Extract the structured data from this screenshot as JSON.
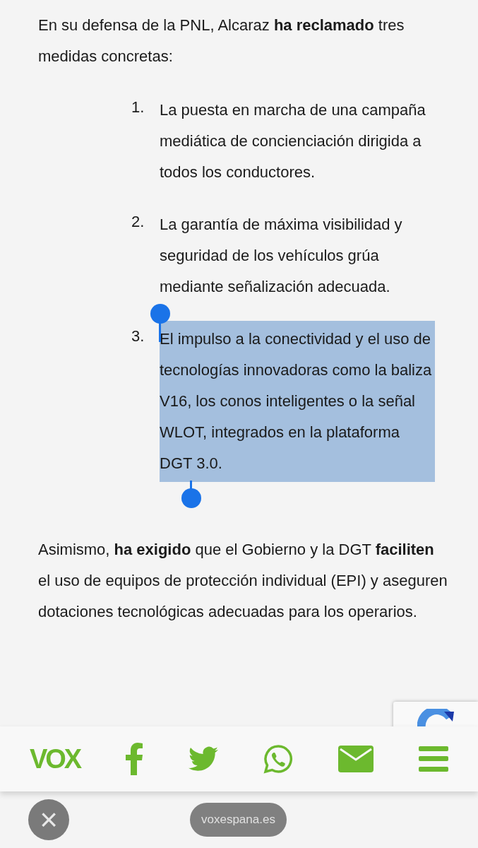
{
  "intro": "En su defensa de la PNL, Alcaraz **ha reclamado** tres medidas concretas:",
  "measures": [
    {
      "number": "1.",
      "text": "La puesta en marcha de una campaña mediática de concienciación dirigida a todos los conductores.",
      "selected": false
    },
    {
      "number": "2.",
      "text": "La garantía de máxima visibilidad y seguridad de los vehículos grúa mediante señalización adecuada.",
      "selected": false
    },
    {
      "number": "3.",
      "text": "El impulso a la conectividad y el uso de tecnologías innovadoras como la baliza V16, los conos inteligentes o la señal WLOT, integrados en la plataforma DGT 3.0.",
      "selected": true
    }
  ],
  "paragraph": "Asimismo, **ha exigido** que el Gobierno y la DGT **faciliten** el uso de equipos de protección individual (EPI) y aseguren dotaciones tecnológicas adecuadas para los operarios.",
  "share_bar": {
    "logo": "VOX",
    "items": [
      {
        "kind": "facebook"
      },
      {
        "kind": "twitter"
      },
      {
        "kind": "whatsapp"
      },
      {
        "kind": "email"
      },
      {
        "kind": "menu"
      }
    ]
  },
  "browser": {
    "close": "×",
    "url": "voxespana.es"
  }
}
